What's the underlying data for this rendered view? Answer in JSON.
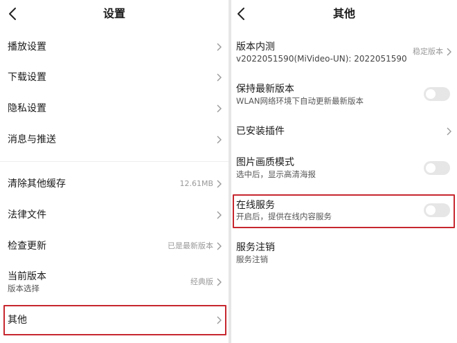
{
  "left": {
    "title": "设置",
    "items": [
      {
        "label": "播放设置"
      },
      {
        "label": "下载设置"
      },
      {
        "label": "隐私设置"
      },
      {
        "label": "消息与推送"
      },
      {
        "label": "清除其他缓存",
        "value": "12.61MB"
      },
      {
        "label": "法律文件"
      },
      {
        "label": "检查更新",
        "value": "已是最新版本"
      },
      {
        "label": "当前版本",
        "sub": "版本选择",
        "value": "经典版"
      },
      {
        "label": "其他"
      }
    ]
  },
  "right": {
    "title": "其他",
    "version": {
      "label": "版本内测",
      "sub": "v2022051590(MiVideo-UN): 2022051590",
      "value": "稳定版本"
    },
    "keep_latest": {
      "label": "保持最新版本",
      "sub": "WLAN网络环境下自动更新最新版本",
      "enabled": false
    },
    "plugins": {
      "label": "已安装插件"
    },
    "image_quality": {
      "label": "图片画质模式",
      "sub": "选中后，显示高清海报",
      "enabled": false
    },
    "online_service": {
      "label": "在线服务",
      "sub": "开启后，提供在线内容服务",
      "enabled": false
    },
    "logout": {
      "label": "服务注销",
      "sub": "服务注销"
    }
  },
  "colors": {
    "highlight": "#c6262e",
    "toggle_off": "#e6e6e6",
    "secondary_text": "#999999"
  },
  "icons": {
    "back": "chevron-left-icon",
    "row_arrow": "chevron-right-icon"
  }
}
